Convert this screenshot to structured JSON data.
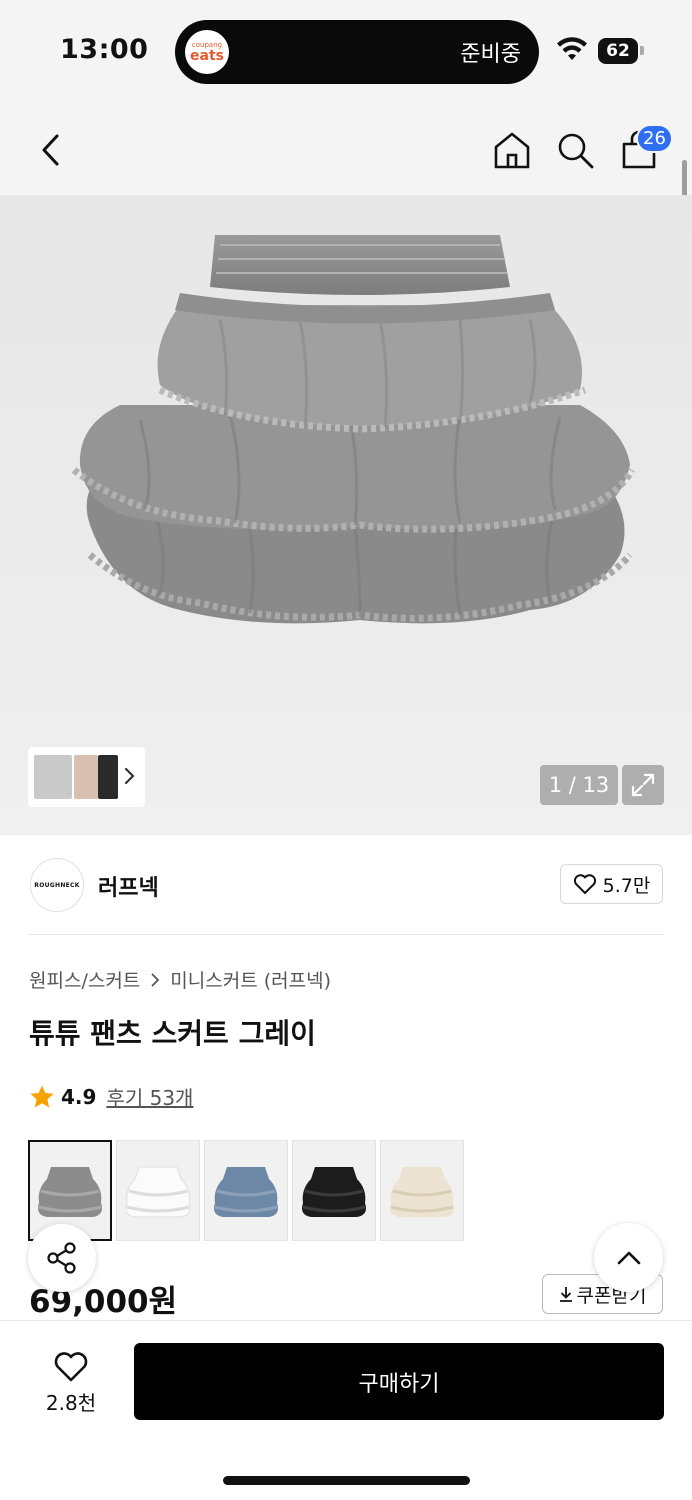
{
  "status_bar": {
    "time": "13:00",
    "live_activity_logo_top": "coupang",
    "live_activity_logo_bottom": "eats",
    "live_activity_text": "준비중",
    "battery": "62"
  },
  "nav": {
    "cart_count": "26"
  },
  "gallery": {
    "counter": "1 / 13"
  },
  "brand": {
    "logo_text": "ROUGHNECK",
    "name": "러프넥",
    "likes": "5.7만"
  },
  "breadcrumb": {
    "category": "원피스/스커트",
    "subcategory": "미니스커트 (러프넥)"
  },
  "product": {
    "title": "튜튜 팬츠 스커트 그레이",
    "rating": "4.9",
    "reviews": "후기 53개",
    "price": "69,000원",
    "coupon_label": "쿠폰받기"
  },
  "swatches": [
    {
      "color": "#8c8c8c",
      "name": "grey"
    },
    {
      "color": "#f4f4f4",
      "name": "white"
    },
    {
      "color": "#6d88a6",
      "name": "blue"
    },
    {
      "color": "#1c1c1c",
      "name": "black"
    },
    {
      "color": "#ece3d3",
      "name": "ivory"
    }
  ],
  "bottom_bar": {
    "like_count": "2.8천",
    "buy_label": "구매하기"
  },
  "colors": {
    "accent": "#2e6ff1",
    "rating_star": "#f5a300",
    "buy_button": "#000000"
  }
}
